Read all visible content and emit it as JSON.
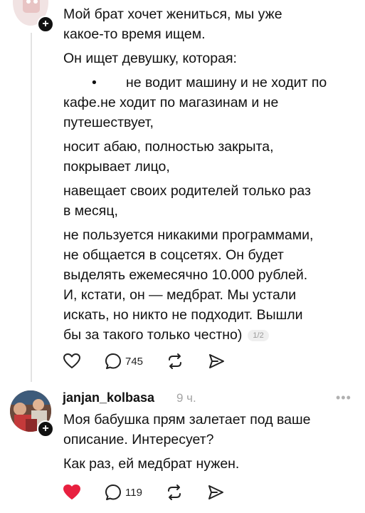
{
  "post": {
    "lines": [
      "Мой брат хочет жениться, мы уже",
      "какое-то время ищем.",
      "Он ищет девушку, которая:",
      "не водит машину и не ходит по",
      "кафе.не ходит по магазинам и не",
      "путешествует,",
      "носит абаю, полностью закрыта,",
      "покрывает лицо,",
      "навещает своих родителей только раз",
      "в месяц,",
      "не пользуется никакими программами,",
      "не общается в соцсетях. Он будет",
      "выделять ежемесячно 10.000 рублей.",
      "И, кстати, он — медбрат. Мы устали",
      "искать, но никто не подходит. Вышли",
      "бы за такого только честно)"
    ],
    "bullet": "•",
    "page_indicator": "1/2",
    "reply_count": "745"
  },
  "reply": {
    "username": "janjan_kolbasa",
    "time": "9 ч.",
    "more": "•••",
    "lines": [
      "Моя бабушка прям залетает под ваше",
      "описание. Интересует?",
      "Как раз, ей медбрат нужен."
    ],
    "reply_count": "119",
    "liked": true,
    "like_color": "#e8203f"
  },
  "plus_glyph": "+",
  "icons": [
    "heart-icon",
    "comment-icon",
    "repost-icon",
    "share-icon"
  ]
}
